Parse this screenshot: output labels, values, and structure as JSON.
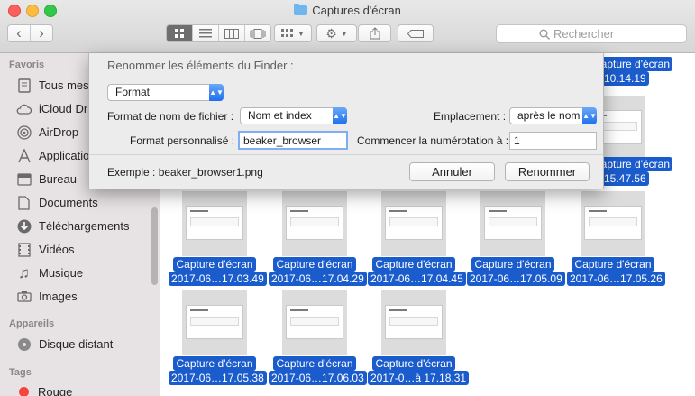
{
  "window": {
    "title": "Captures d'écran"
  },
  "toolbar": {
    "back": "‹",
    "forward": "›",
    "search_placeholder": "Rechercher"
  },
  "sidebar": {
    "favorites_header": "Favoris",
    "favorites": [
      {
        "label": "Tous mes",
        "icon": "all-files-icon"
      },
      {
        "label": "iCloud Dr",
        "icon": "cloud-icon"
      },
      {
        "label": "AirDrop",
        "icon": "airdrop-icon"
      },
      {
        "label": "Applicatio",
        "icon": "applications-icon"
      },
      {
        "label": "Bureau",
        "icon": "desktop-icon"
      },
      {
        "label": "Documents",
        "icon": "document-icon"
      },
      {
        "label": "Téléchargements",
        "icon": "download-icon"
      },
      {
        "label": "Vidéos",
        "icon": "video-icon"
      },
      {
        "label": "Musique",
        "icon": "music-icon"
      },
      {
        "label": "Images",
        "icon": "camera-icon"
      }
    ],
    "devices_header": "Appareils",
    "devices": [
      {
        "label": "Disque distant",
        "icon": "disc-icon"
      }
    ],
    "tags_header": "Tags",
    "tags": [
      {
        "label": "Rouge",
        "color": "#f3453c"
      }
    ]
  },
  "files": {
    "right_column": [
      {
        "line1": "Capture d'écran",
        "line2": "…10.14.19"
      },
      {
        "line1": "Capture d'écran",
        "line2": "…15.47.56"
      }
    ],
    "row1": [
      {
        "line1": "Capture d'écran",
        "line2": "2017-06…17.03.49"
      },
      {
        "line1": "Capture d'écran",
        "line2": "2017-06…17.04.29"
      },
      {
        "line1": "Capture d'écran",
        "line2": "2017-06…17.04.45"
      },
      {
        "line1": "Capture d'écran",
        "line2": "2017-06…17.05.09"
      },
      {
        "line1": "Capture d'écran",
        "line2": "2017-06…17.05.26"
      }
    ],
    "row2": [
      {
        "line1": "Capture d'écran",
        "line2": "2017-06…17.05.38"
      },
      {
        "line1": "Capture d'écran",
        "line2": "2017-06…17.06.03"
      },
      {
        "line1": "Capture d'écran",
        "line2": "2017-0…à 17.18.31"
      }
    ]
  },
  "dialog": {
    "title": "Renommer les éléments du Finder :",
    "mode": "Format",
    "name_format_label": "Format de nom de fichier :",
    "name_format_value": "Nom et index",
    "location_label": "Emplacement :",
    "location_value": "après le nom",
    "custom_format_label": "Format personnalisé :",
    "custom_format_value": "beaker_browser",
    "start_number_label": "Commencer la numérotation à :",
    "start_number_value": "1",
    "example": "Exemple : beaker_browser1.png",
    "cancel": "Annuler",
    "rename": "Renommer"
  }
}
